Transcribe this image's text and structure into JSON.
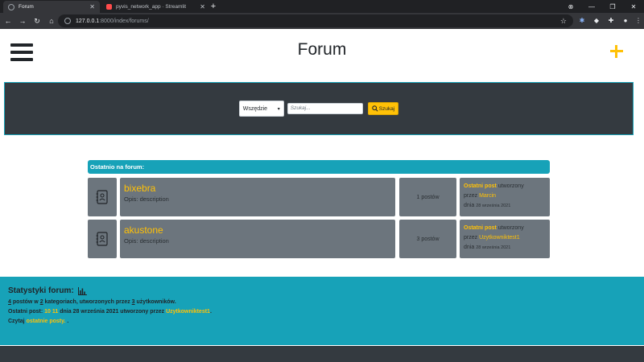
{
  "browser": {
    "tabs": [
      {
        "label": "Forum",
        "active": true
      },
      {
        "label": "pyvis_network_app · Streamlit",
        "active": false
      }
    ],
    "url_host": "127.0.0.1",
    "url_rest": ":8000/index/forums/"
  },
  "header": {
    "title": "Forum"
  },
  "search": {
    "scope_selected": "Wszędzie",
    "placeholder": "Szukaj...",
    "button_label": "Szukaj"
  },
  "latest": {
    "heading": "Ostatnio na forum:",
    "forums": [
      {
        "name": "bixebra",
        "description": "Opis: description",
        "post_count": "1 postów",
        "last_post_label": "Ostatni post",
        "created_text": " utworzony",
        "by_text": "przez ",
        "author": "Marcin",
        "date_prefix": "dnia ",
        "date": "28 września 2021"
      },
      {
        "name": "akustone",
        "description": "Opis: description",
        "post_count": "3 postów",
        "last_post_label": "Ostatni post",
        "created_text": " utworzony",
        "by_text": "przez ",
        "author": "Uzytkowniktest1",
        "date_prefix": "dnia ",
        "date": "28 września 2021"
      }
    ]
  },
  "stats": {
    "title": "Statystyki forum:",
    "posts_count": "4",
    "posts_text": " postów w ",
    "categories_count": "2",
    "categories_text": " kategoriach, utworzonych przez ",
    "users_count": "3",
    "users_text": " użytkowników.",
    "last_post_prefix": "Ostatni post: ",
    "last_post_link": "10 11",
    "last_post_middle": " dnia 28 września 2021 utworzony przez ",
    "last_post_author": "Uzytkowniktest1",
    "last_post_suffix": ".",
    "read_prefix": "Czytaj ",
    "read_link": "ostatnie posty.",
    "read_suffix": " ."
  },
  "colors": {
    "accent": "#ffc107",
    "teal": "#17a2b8",
    "dark": "#343a40",
    "card": "#6c757d"
  }
}
